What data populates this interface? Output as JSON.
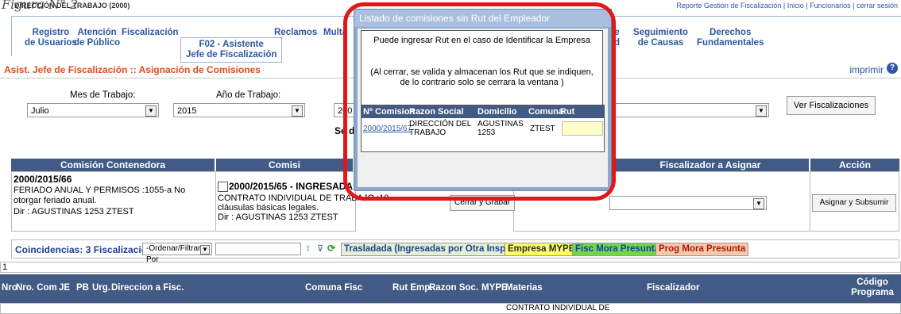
{
  "figure_label": "Figura N° 2",
  "org": "DIRECCIÓN DEL TRABAJO (2000)",
  "top_links": "Reporte Gestión de Fiscalización | Inicio | Funcionarios | cerrar sesión",
  "tabs": [
    {
      "line1": "Registro",
      "line2": "de Usuarios"
    },
    {
      "line1": "Atención",
      "line2": "de Público"
    },
    {
      "line1": "Fiscalización",
      "line2": ""
    },
    {
      "line1": "F02 - Asistente",
      "line2": "Jefe de Fiscalización"
    },
    {
      "line1": "Reclamos",
      "line2": ""
    },
    {
      "line1": "Multa",
      "line2": ""
    },
    {
      "line1": "e",
      "line2": "d"
    },
    {
      "line1": "Seguimiento",
      "line2": "de Causas"
    },
    {
      "line1": "Derechos",
      "line2": "Fundamentales"
    }
  ],
  "page_title": "Asist. Jefe de Fiscalización :: Asignación de Comisiones",
  "print_label": "imprimir",
  "filters": {
    "mes_label": "Mes de Trabajo:",
    "mes_value": "Julio",
    "anio_label": "Año de Trabajo:",
    "anio_value": "2015",
    "third_value": "200",
    "sel_label_partial": "Se de",
    "ver_button": "Ver Fiscalizaciones"
  },
  "table_headers": {
    "contenedora": "Comisión Contenedora",
    "comision": "Comisi",
    "fiscalizador": "Fiscalizador a Asignar",
    "accion": "Acción"
  },
  "contenedora": {
    "code": "2000/2015/66",
    "desc": "FERIADO ANUAL Y PERMISOS :1055-a No otorgar feriado anual.",
    "dir": "Dir : AGUSTINAS 1253 ZTEST"
  },
  "comision": {
    "code": "2000/2015/65 - INGRESADA",
    "desc": "CONTRATO INDIVIDUAL DE TRABAJO :10",
    "desc2": "cláusulas básicas legales.",
    "dir": "Dir : AGUSTINAS 1253 ZTEST"
  },
  "asignar_button": "Asignar y Subsumir",
  "coincidencias": {
    "label": "Coincidencias: 3 Fiscalización(s)",
    "order_select": "-Ordenar/Filtrar Por",
    "legend": [
      {
        "text": "Trasladada (Ingresadas por Otra Inspección)",
        "bg": "#e3f0d6",
        "color": "#1f3f95"
      },
      {
        "text": "Empresa MYPE",
        "bg": "#ffff66",
        "color": "#2b2b2b"
      },
      {
        "text": "Fisc Mora Presunta",
        "bg": "#6fd64f",
        "color": "#1f3f95"
      },
      {
        "text": "Prog Mora Presunta",
        "bg": "#f6c9a8",
        "color": "#b01414"
      }
    ]
  },
  "row_count": "1",
  "result_columns": [
    "Nro",
    "Nro. Com",
    "JE",
    "PB",
    "Urg.",
    "Direccion a Fisc.",
    "Comuna Fisc",
    "Rut Emp.",
    "Razon Soc.",
    "MYPE",
    "Materias",
    "Fiscalizador",
    "Código Programa"
  ],
  "partial_row_text": "CONTRATO INDIVIDUAL DE",
  "popup": {
    "title": "Listado de comisiones sin Rut del Empleador",
    "info1": "Puede ingresar Rut en el caso de Identificar la Empresa",
    "info2": "(Al cerrar, se valida y almacenan los Rut que se indiquen, de lo contrario solo se cerrara la ventana )",
    "columns": [
      "Nº Comision",
      "Razon Social",
      "Domicilio",
      "Comuna",
      "Rut"
    ],
    "row": {
      "comision": "2000/2015/67",
      "razon": "DIRECCIÓN DEL TRABAJO",
      "domicilio": "AGUSTINAS 1253",
      "comuna": "ZTEST",
      "rut": ""
    },
    "close_button": "Cerrar y Grabar"
  },
  "colors": {
    "nav": "#2c58a0",
    "title": "#e04a1c",
    "header": "#425b85",
    "highlight": "#e01818"
  }
}
